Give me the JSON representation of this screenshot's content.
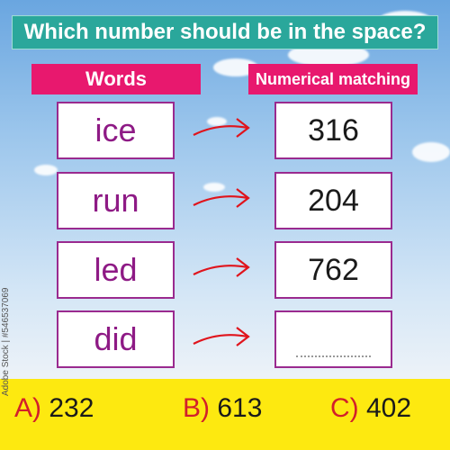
{
  "title": "Which number should be in the space?",
  "headers": {
    "words": "Words",
    "numbers": "Numerical matching"
  },
  "rows": [
    {
      "word": "ice",
      "number": "316"
    },
    {
      "word": "run",
      "number": "204"
    },
    {
      "word": "led",
      "number": "762"
    },
    {
      "word": "did",
      "number": ""
    }
  ],
  "options": [
    {
      "letter": "A)",
      "value": "232"
    },
    {
      "letter": "B)",
      "value": "613"
    },
    {
      "letter": "C)",
      "value": "402"
    }
  ],
  "credit": "Adobe Stock | #546537069",
  "colors": {
    "title_bg": "#2aa79b",
    "header_bg": "#e8186e",
    "box_border": "#9a2a8f",
    "word_text": "#8e1a85",
    "arrow": "#e0141c",
    "answer_band": "#fde910",
    "option_letter": "#d21f2b"
  }
}
